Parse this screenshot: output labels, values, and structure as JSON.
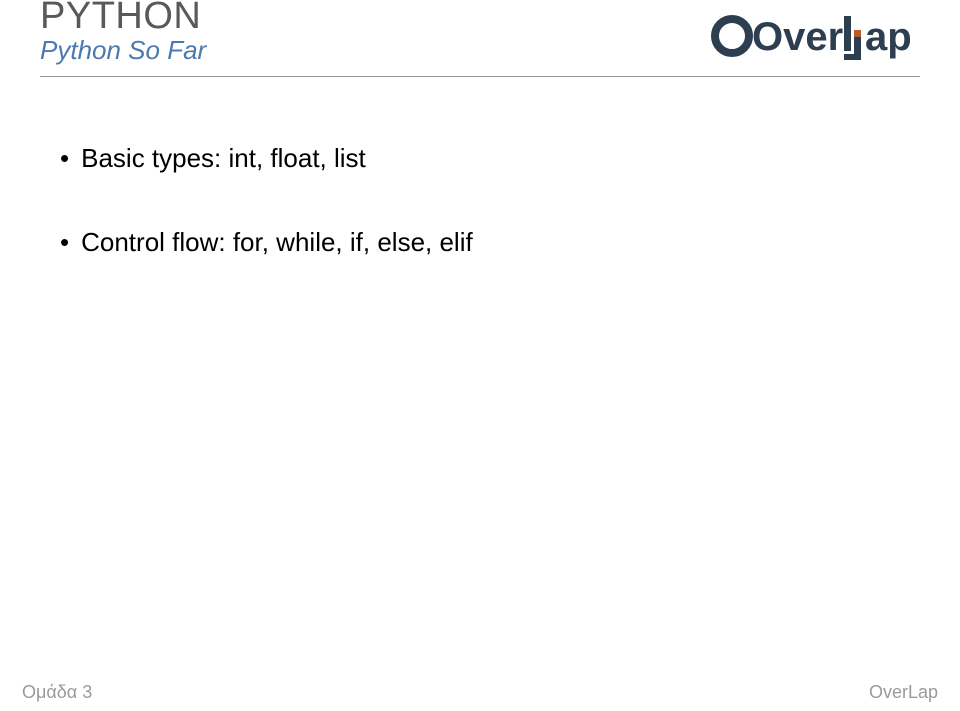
{
  "header": {
    "title": "PYTHON",
    "subtitle": "Python So Far",
    "logo_text_left": "Over",
    "logo_text_right": "ap"
  },
  "content": {
    "bullets": [
      "Basic types: int, float, list",
      "Control flow: for, while, if, else, elif"
    ]
  },
  "footer": {
    "left": "Ομάδα 3",
    "right": "OverLap"
  }
}
